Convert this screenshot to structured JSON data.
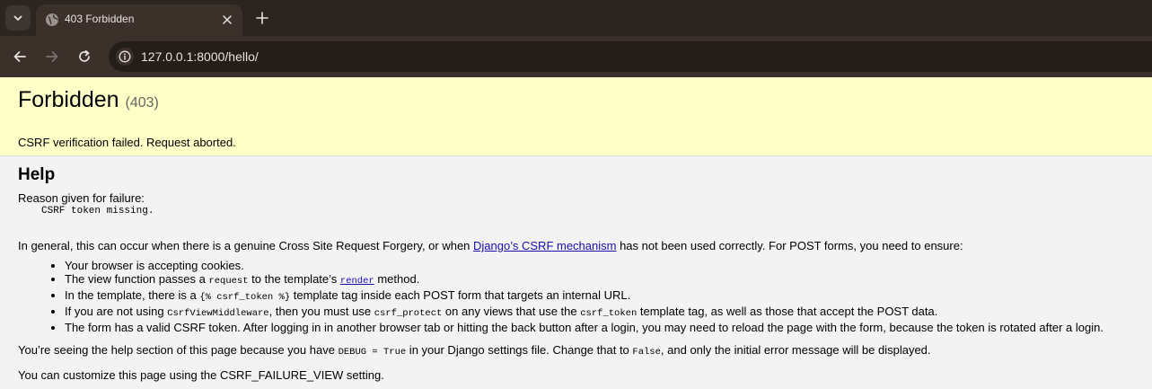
{
  "browser": {
    "tab": {
      "title": "403 Forbidden"
    },
    "address": {
      "url": "127.0.0.1:8000/hello/"
    }
  },
  "error": {
    "title": "Forbidden",
    "code": "(403)",
    "message": "CSRF verification failed. Request aborted."
  },
  "help": {
    "heading": "Help",
    "reason_label": "Reason given for failure:",
    "reason_code": "CSRF token missing.",
    "general_before": "In general, this can occur when there is a genuine Cross Site Request Forgery, or when ",
    "general_link": "Django’s CSRF mechanism",
    "general_after": " has not been used correctly. For POST forms, you need to ensure:",
    "items": {
      "cookies": "Your browser is accepting cookies.",
      "view_before": "The view function passes a ",
      "view_code": "request",
      "view_mid": " to the template’s ",
      "view_link": "render",
      "view_after": " method.",
      "tmpl_before": "In the template, there is a ",
      "tmpl_code": "{% csrf_token %}",
      "tmpl_after": " template tag inside each POST form that targets an internal URL.",
      "mw_before": "If you are not using ",
      "mw_code1": "CsrfViewMiddleware",
      "mw_mid1": ", then you must use ",
      "mw_code2": "csrf_protect",
      "mw_mid2": " on any views that use the ",
      "mw_code3": "csrf_token",
      "mw_after": " template tag, as well as those that accept the POST data.",
      "valid": "The form has a valid CSRF token. After logging in in another browser tab or hitting the back button after a login, you may need to reload the page with the form, because the token is rotated after a login."
    },
    "debug_before": "You’re seeing the help section of this page because you have ",
    "debug_code1": "DEBUG = True",
    "debug_mid": " in your Django settings file. Change that to ",
    "debug_code2": "False",
    "debug_after": ", and only the initial error message will be displayed.",
    "customize": "You can customize this page using the CSRF_FAILURE_VIEW setting."
  }
}
